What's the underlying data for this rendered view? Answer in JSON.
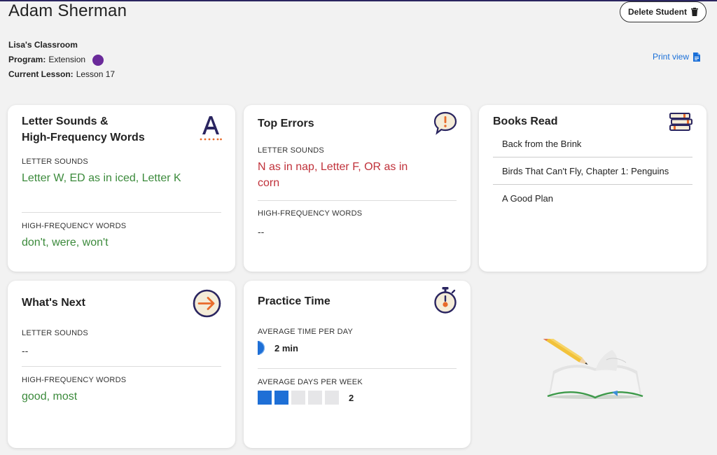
{
  "student": {
    "name": "Adam Sherman"
  },
  "header": {
    "delete_label": "Delete Student",
    "classroom": "Lisa's Classroom",
    "program_label": "Program:",
    "program_value": "Extension",
    "program_color": "#6a2a9a",
    "lesson_label": "Current Lesson:",
    "lesson_value": "Lesson 17",
    "print_label": "Print view"
  },
  "cards": {
    "letter_sounds": {
      "title_line1": "Letter Sounds &",
      "title_line2": "High-Frequency Words",
      "icon": "letter-a-icon",
      "letter_sounds_label": "LETTER SOUNDS",
      "letter_sounds_value": "Letter W, ED as in iced, Letter K",
      "hfw_label": "HIGH-FREQUENCY WORDS",
      "hfw_value": "don't, were, won't"
    },
    "top_errors": {
      "title": "Top Errors",
      "icon": "exclamation-bubble-icon",
      "letter_sounds_label": "LETTER SOUNDS",
      "letter_sounds_value_line1": "N as in nap, Letter F, OR as in",
      "letter_sounds_value_line2": "corn",
      "hfw_label": "HIGH-FREQUENCY WORDS",
      "hfw_value": "--"
    },
    "books_read": {
      "title": "Books Read",
      "icon": "books-stack-icon",
      "books": [
        "Back from the Brink",
        "Birds That Can't Fly, Chapter 1: Penguins",
        "A Good Plan"
      ]
    },
    "whats_next": {
      "title": "What's Next",
      "icon": "arrow-right-circle-icon",
      "letter_sounds_label": "LETTER SOUNDS",
      "letter_sounds_value": "--",
      "hfw_label": "HIGH-FREQUENCY WORDS",
      "hfw_value": "good, most"
    },
    "practice_time": {
      "title": "Practice Time",
      "icon": "stopwatch-icon",
      "avg_time_label": "AVERAGE TIME PER DAY",
      "avg_time_value": "2 min",
      "avg_days_label": "AVERAGE DAYS PER WEEK",
      "avg_days_value": "2",
      "days_active": 2,
      "days_total": 5
    }
  },
  "colors": {
    "accent_blue": "#1e6fd6",
    "green": "#3b8a3b",
    "red": "#c0313a",
    "navy": "#2a2560",
    "orange": "#e86a2a"
  }
}
